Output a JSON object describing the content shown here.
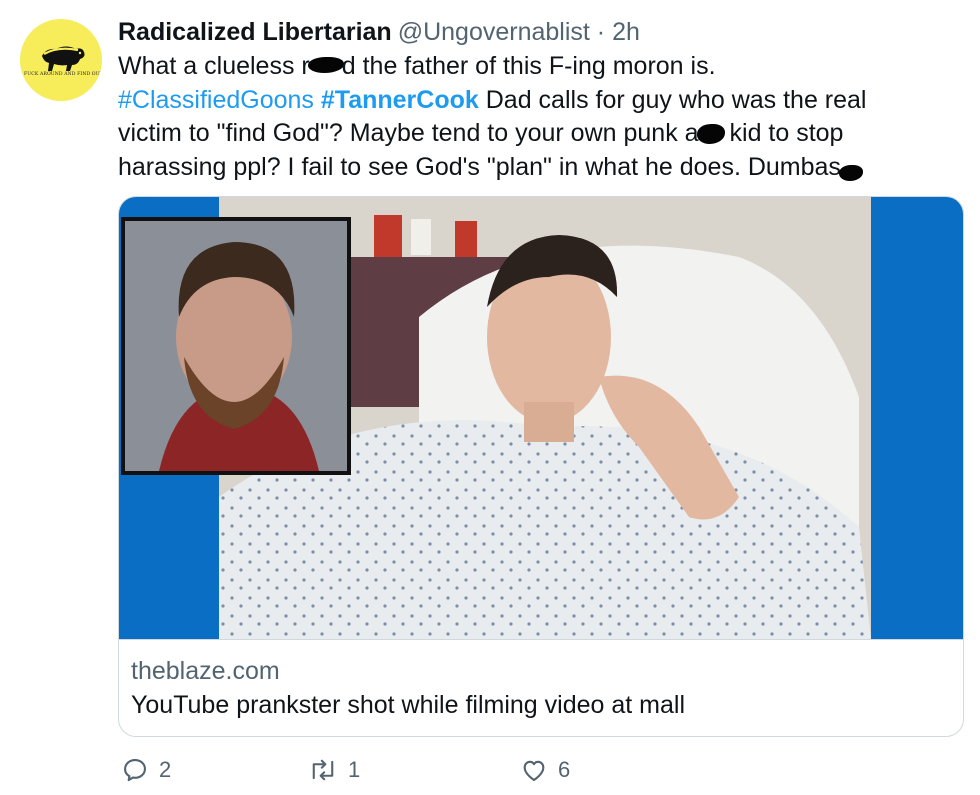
{
  "tweet": {
    "author": {
      "display_name": "Radicalized Libertarian",
      "handle": "@Ungovernablist",
      "separator": "·",
      "time": "2h",
      "avatar_caption": "FUCK AROUND AND FIND OUT",
      "avatar_bg": "#f7ec5a"
    },
    "body": {
      "line1_a": "What a clueless r",
      "line1_b": "d the father of this F-ing moron is.",
      "hashtag1": "#ClassifiedGoons",
      "hashtag2": "#TannerCook",
      "line2_rest": " Dad calls for guy who was the real",
      "line3_a": "victim to \"find God\"? Maybe tend to your own punk a",
      "line3_b": " kid to stop",
      "line4_a": "harassing ppl? I fail to see God's \"plan\" in what he does. Dumbas",
      "redaction_icon": "scribble-redaction"
    },
    "card": {
      "domain": "theblaze.com",
      "title": "YouTube prankster shot while filming video at mall",
      "image_description_icon": "news-photo"
    },
    "actions": {
      "reply": {
        "icon": "reply-icon",
        "count": "2"
      },
      "retweet": {
        "icon": "retweet-icon",
        "count": "1"
      },
      "like": {
        "icon": "heart-icon",
        "count": "6"
      }
    },
    "colors": {
      "text": "#0f1419",
      "muted": "#536471",
      "hashtag": "#1d9bf0",
      "border": "#cfd9de",
      "news_blue": "#0a6fc4"
    }
  }
}
